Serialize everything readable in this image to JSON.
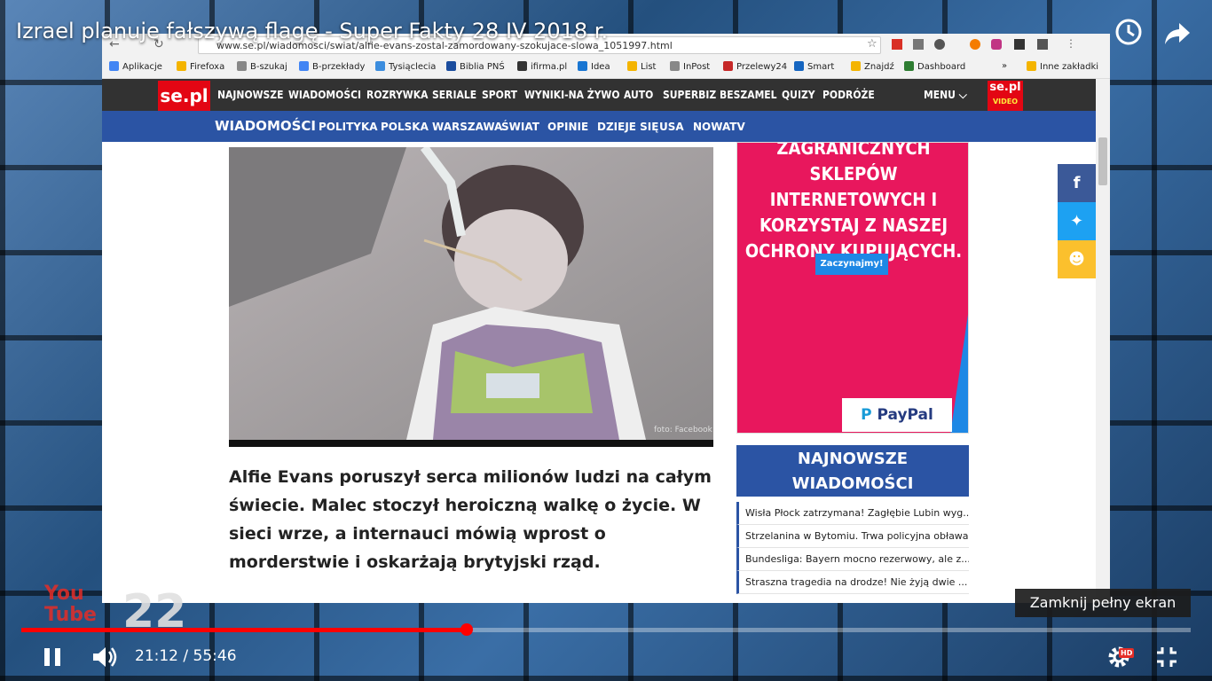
{
  "video": {
    "title": "Izrael planuje fałszywą flagę - Super Fakty 28 IV 2018 r.",
    "time_display": "21:12 / 55:46",
    "progress_fraction": 0.381,
    "tooltip": "Zamknij pełny ekran",
    "overlay_logo_line1": "You",
    "overlay_logo_line2": "Tube",
    "overlay_number": "22",
    "hd_badge": "HD",
    "icons": {
      "watch_later": "clock-icon",
      "share": "share-arrow-icon",
      "play_pause": "pause-icon",
      "volume": "volume-icon",
      "settings": "gear-icon",
      "exit_fullscreen": "exit-fullscreen-icon"
    }
  },
  "browser": {
    "url": "www.se.pl/wiadomosci/swiat/alfie-evans-zostal-zamordowany-szokujace-slowa_1051997.html",
    "bookmarks": [
      {
        "label": "Aplikacje",
        "color": "#4285f4"
      },
      {
        "label": "Firefoxa",
        "color": "#f4b400"
      },
      {
        "label": "B-szukaj",
        "color": "#888888"
      },
      {
        "label": "B-przekłady",
        "color": "#4285f4"
      },
      {
        "label": "Tysiąclecia",
        "color": "#3c8dde"
      },
      {
        "label": "Biblia PNŚ",
        "color": "#1b4d9e"
      },
      {
        "label": "ifirma.pl",
        "color": "#333333"
      },
      {
        "label": "Idea",
        "color": "#1976d2"
      },
      {
        "label": "List",
        "color": "#f4b400"
      },
      {
        "label": "InPost",
        "color": "#888888"
      },
      {
        "label": "Przelewy24",
        "color": "#c62828"
      },
      {
        "label": "Smart",
        "color": "#1565c0"
      },
      {
        "label": "Znajdź",
        "color": "#f4b400"
      },
      {
        "label": "Dashboard",
        "color": "#2e7d32"
      },
      {
        "label": "Inne zakładki",
        "color": "#f4b400"
      }
    ],
    "bookmarks_more": "»"
  },
  "site": {
    "logo": "se.pl",
    "video_logo": "se.pl",
    "video_logo_sub": "VIDEO",
    "nav1": [
      "NAJNOWSZE",
      "WIADOMOŚCI",
      "ROZRYWKA",
      "SERIALE",
      "SPORT",
      "WYNIKI-NA ŻYWO",
      "AUTO",
      "SUPERBIZ",
      "BESZAMEL",
      "QUIZY",
      "PODRÓŻE"
    ],
    "menu_label": "MENU",
    "section": "WIADOMOŚCI",
    "nav2": [
      "POLITYKA",
      "POLSKA",
      "WARSZAWA",
      "ŚWIAT",
      "OPINIE",
      "DZIEJE SIĘ",
      "USA",
      "NOWATV"
    ],
    "photo_credit": "foto: Facebook",
    "lead": "Alfie Evans poruszył serca milionów ludzi na całym świecie. Malec stoczył heroiczną walkę o życie. W sieci wrze, a internauci mówią wprost o morderstwie i oskarżają brytyjski rząd.",
    "ad": {
      "line1": "ZAGRANICZNYCH SKLEPÓW",
      "line2": "INTERNETOWYCH I",
      "line3": "KORZYSTAJ Z NASZEJ",
      "line4": "OCHRONY KUPUJĄCYCH.",
      "button": "Zaczynajmy!",
      "brand": "PayPal"
    },
    "latest_title_1": "NAJNOWSZE",
    "latest_title_2": "WIADOMOŚCI",
    "latest": [
      "Wisła Płock zatrzymana! Zagłębie Lubin wyg...",
      "Strzelanina w Bytomiu. Trwa policyjna obława",
      "Bundesliga: Bayern mocno rezerwowy, ale z...",
      "Straszna tragedia na drodze! Nie żyją dwie ..."
    ],
    "share_buttons": [
      {
        "name": "facebook",
        "glyph": "f",
        "color": "#3b5998"
      },
      {
        "name": "twitter",
        "glyph": "t",
        "color": "#1da1f2"
      },
      {
        "name": "snapchat",
        "glyph": "s",
        "color": "#fbc02d"
      }
    ]
  }
}
